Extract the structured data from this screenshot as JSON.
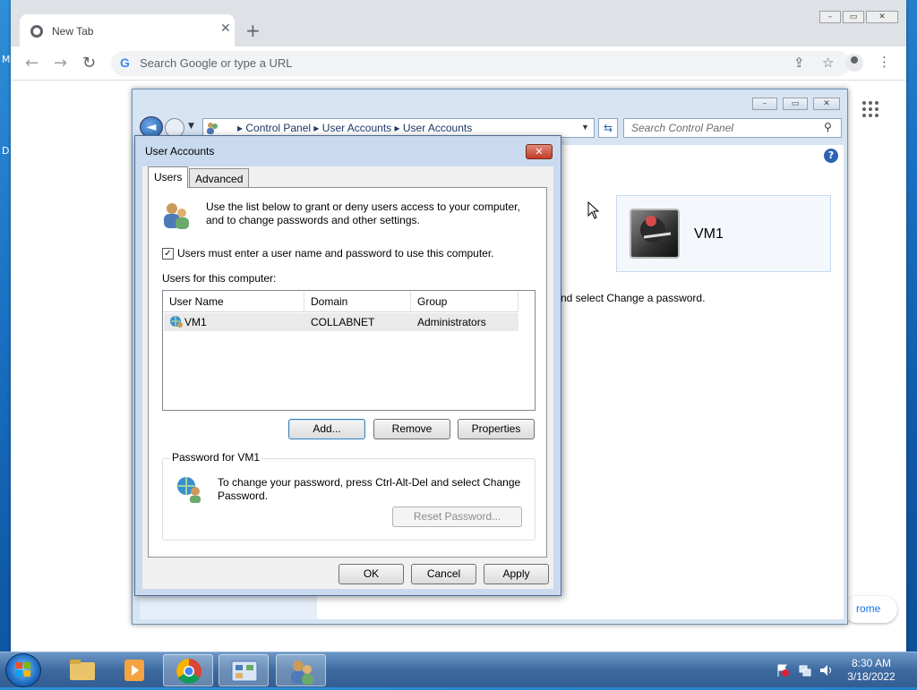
{
  "desktop": {
    "left_fragments": [
      "M",
      "D"
    ]
  },
  "browser": {
    "tab_title": "New Tab",
    "tab_close": "✕",
    "new_tab": "+",
    "omnibox_placeholder": "Search Google or type a URL",
    "omnibox_g": "G",
    "back": "←",
    "forward": "→",
    "reload": "↻",
    "share_icon": "⇪",
    "bookmark_icon": "☆",
    "menu_icon": "⋮",
    "apps_icon": "⋮⋮⋮",
    "pill_text": "rome",
    "window_controls": [
      "–",
      "▭",
      "✕"
    ]
  },
  "control_panel": {
    "breadcrumb": [
      "Control Panel",
      "User Accounts",
      "User Accounts"
    ],
    "search_placeholder": "Search Control Panel",
    "help": "?",
    "user_name": "VM1",
    "hint_text": "nd select Change a password.",
    "window_controls": [
      "–",
      "▭",
      "✕"
    ]
  },
  "dialog": {
    "title": "User Accounts",
    "close": "✕",
    "tabs": [
      "Users",
      "Advanced"
    ],
    "intro": [
      "Use the list below to grant or deny users access to your computer,",
      "and to change passwords and other settings."
    ],
    "checkbox_label": "Users must enter a user name and password to use this computer.",
    "checkbox_checked": true,
    "list_caption": "Users for this computer:",
    "columns": [
      "User Name",
      "Domain",
      "Group"
    ],
    "rows": [
      {
        "user": "VM1",
        "domain": "COLLABNET",
        "group": "Administrators"
      }
    ],
    "buttons": {
      "add": "Add...",
      "remove": "Remove",
      "properties": "Properties"
    },
    "password_group": {
      "title": "Password for VM1",
      "text": [
        "To change your password, press Ctrl-Alt-Del and select Change",
        "Password."
      ],
      "reset": "Reset Password..."
    },
    "footer": {
      "ok": "OK",
      "cancel": "Cancel",
      "apply": "Apply"
    }
  },
  "taskbar": {
    "time": "8:30 AM",
    "date": "3/18/2022"
  }
}
